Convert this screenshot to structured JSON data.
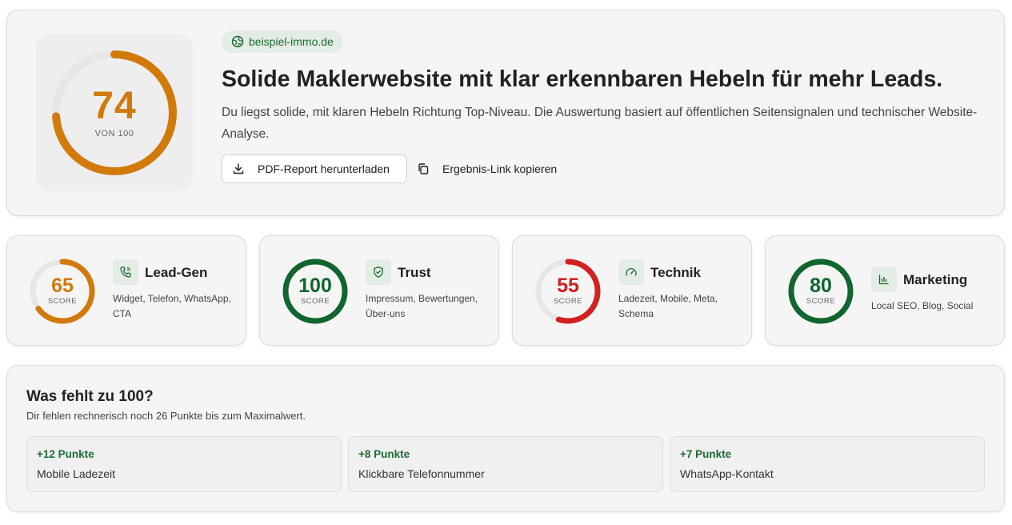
{
  "hero": {
    "score": "74",
    "score_of": "VON 100",
    "score_fraction": 0.74,
    "domain": "beispiel-immo.de",
    "title": "Solide Maklerwebsite mit klar erkennbaren Hebeln für mehr Leads.",
    "description": "Du liegst solide, mit klaren Hebeln Richtung Top-Niveau. Die Auswertung basiert auf öffentlichen Seitensignalen und technischer Website-Analyse.",
    "pdf_button": "PDF-Report herunterladen",
    "copy_button": "Ergebnis-Link kopieren"
  },
  "categories": [
    {
      "score": "65",
      "score_label": "SCORE",
      "title": "Lead-Gen",
      "desc": "Widget, Telefon, WhatsApp, CTA",
      "icon": "phone-icon",
      "color": "#d17a0a",
      "fraction": 0.65
    },
    {
      "score": "100",
      "score_label": "SCORE",
      "title": "Trust",
      "desc": "Impressum, Bewertungen, Über-uns",
      "icon": "shield-check-icon",
      "color": "#11652e",
      "fraction": 1.0
    },
    {
      "score": "55",
      "score_label": "SCORE",
      "title": "Technik",
      "desc": "Ladezeit, Mobile, Meta, Schema",
      "icon": "gauge-icon",
      "color": "#d32020",
      "fraction": 0.55
    },
    {
      "score": "80",
      "score_label": "SCORE",
      "title": "Marketing",
      "desc": "Local SEO, Blog, Social",
      "icon": "bar-chart-icon",
      "color": "#11652e",
      "fraction": 1.0
    }
  ],
  "missing": {
    "title": "Was fehlt zu 100?",
    "subtitle": "Dir fehlen rechnerisch noch 26 Punkte bis zum Maximalwert.",
    "items": [
      {
        "points": "+12 Punkte",
        "name": "Mobile Ladezeit"
      },
      {
        "points": "+8 Punkte",
        "name": "Klickbare Telefonnummer"
      },
      {
        "points": "+7 Punkte",
        "name": "WhatsApp-Kontakt"
      }
    ]
  },
  "colors": {
    "orange": "#d17a0a",
    "green": "#11652e",
    "red": "#d32020",
    "track": "#e6e6e6"
  }
}
